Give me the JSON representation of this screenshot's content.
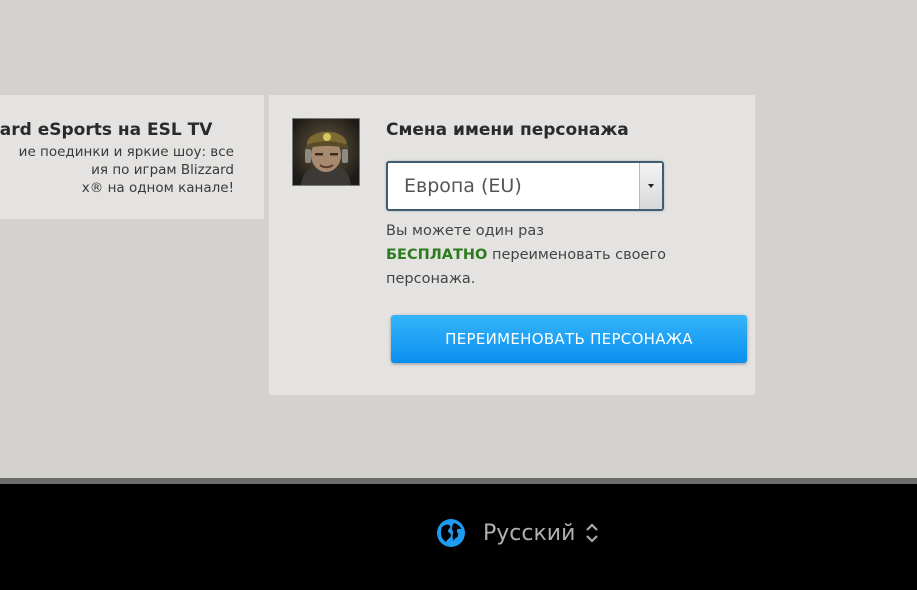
{
  "promo": {
    "title": "zzard eSports на ESL TV",
    "lines": [
      "ие поединки и яркие шоу: все",
      "ия по играм Blizzard",
      "x® на одном канале!"
    ]
  },
  "rename": {
    "title": "Смена имени персонажа",
    "region_selected": "Европа (EU)",
    "info_prefix": "Вы можете один раз",
    "info_free": "БЕСПЛАТНО",
    "info_suffix": "переименовать своего персонажа.",
    "button_label": "ПЕРЕИМЕНОВАТЬ ПЕРСОНАЖА"
  },
  "footer": {
    "language_label": "Русский"
  },
  "colors": {
    "accent_button": "#0a8ff0",
    "free_highlight": "#2c7b1f",
    "globe": "#1e9bf0"
  },
  "icons": {
    "portrait": "character-portrait",
    "select": "dropdown-arrow-icon",
    "globe": "globe-icon",
    "language_toggle": "chevron-updown-icon"
  }
}
